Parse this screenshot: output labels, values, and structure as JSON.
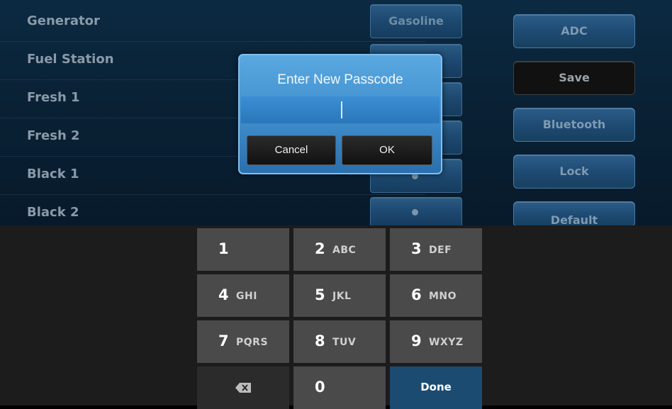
{
  "rows": [
    {
      "label": "Generator",
      "selector": "Gasoline"
    },
    {
      "label": "Fuel Station",
      "selector": ""
    },
    {
      "label": "Fresh 1",
      "selector": ""
    },
    {
      "label": "Fresh 2",
      "selector": ""
    },
    {
      "label": "Black 1",
      "selector": ""
    },
    {
      "label": "Black 2",
      "selector": ""
    }
  ],
  "side_buttons": [
    "ADC",
    "Save",
    "Bluetooth",
    "Lock",
    "Default"
  ],
  "dialog": {
    "title": "Enter New Passcode",
    "value": "",
    "cancel_label": "Cancel",
    "ok_label": "OK"
  },
  "keypad": {
    "keys": [
      {
        "digit": "1",
        "letters": ""
      },
      {
        "digit": "2",
        "letters": "ABC"
      },
      {
        "digit": "3",
        "letters": "DEF"
      },
      {
        "digit": "4",
        "letters": "GHI"
      },
      {
        "digit": "5",
        "letters": "JKL"
      },
      {
        "digit": "6",
        "letters": "MNO"
      },
      {
        "digit": "7",
        "letters": "PQRS"
      },
      {
        "digit": "8",
        "letters": "TUV"
      },
      {
        "digit": "9",
        "letters": "WXYZ"
      }
    ],
    "zero": "0",
    "done_label": "Done",
    "backspace_icon": "backspace-icon"
  },
  "colors": {
    "dialog_accent": "#3f8dcc",
    "done_key": "#1c4b72"
  }
}
